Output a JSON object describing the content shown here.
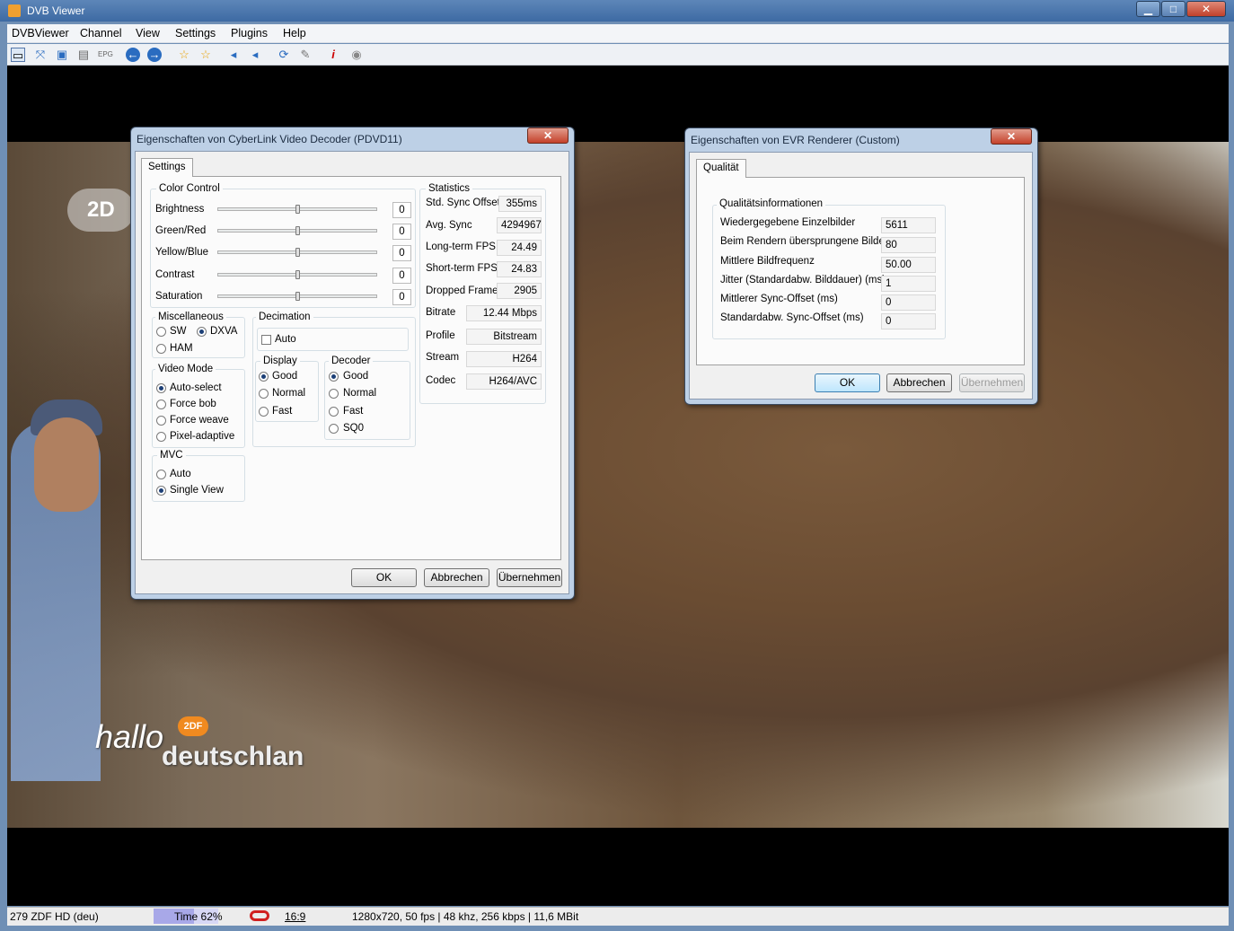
{
  "app": {
    "title": "DVB Viewer"
  },
  "window_buttons": {
    "minimize": "▁",
    "maximize": "□",
    "close": "✕"
  },
  "menu": [
    "DVBViewer",
    "Channel",
    "View",
    "Settings",
    "Plugins",
    "Help"
  ],
  "toolbar_icons": [
    "window-icon",
    "fullscreen-icon",
    "desktop-icon",
    "osd-icon",
    "epg-icon",
    "back-icon",
    "forward-icon",
    "favorite-icon",
    "favorite2-icon",
    "volume-down-icon",
    "volume-up-icon",
    "record-icon",
    "tools-icon",
    "info-icon",
    "stop-icon"
  ],
  "video": {
    "logo": "2D",
    "overlay_line1": "hallo",
    "overlay_line2": "deutschlan",
    "overlay_logo": "2DF"
  },
  "statusbar": {
    "channel": "279 ZDF HD (deu)",
    "time": "Time 62%",
    "time_progress": 0.62,
    "aspect": "16:9",
    "info": "1280x720, 50 fps | 48 khz, 256 kbps | 11,6 MBit"
  },
  "decoder_dialog": {
    "title": "Eigenschaften von CyberLink Video Decoder (PDVD11)",
    "tab": "Settings",
    "color_control": {
      "label": "Color Control",
      "rows": [
        {
          "label": "Brightness",
          "value": "0"
        },
        {
          "label": "Green/Red",
          "value": "0"
        },
        {
          "label": "Yellow/Blue",
          "value": "0"
        },
        {
          "label": "Contrast",
          "value": "0"
        },
        {
          "label": "Saturation",
          "value": "0"
        }
      ]
    },
    "misc": {
      "label": "Miscellaneous",
      "sw": "SW",
      "dxva": "DXVA",
      "ham": "HAM"
    },
    "decimation": {
      "label": "Decimation",
      "auto": "Auto"
    },
    "display": {
      "label": "Display",
      "options": [
        "Good",
        "Normal",
        "Fast"
      ]
    },
    "decoder": {
      "label": "Decoder",
      "options": [
        "Good",
        "Normal",
        "Fast",
        "SQ0"
      ]
    },
    "video_mode": {
      "label": "Video Mode",
      "options": [
        "Auto-select",
        "Force bob",
        "Force weave",
        "Pixel-adaptive"
      ]
    },
    "mvc": {
      "label": "MVC",
      "options": [
        "Auto",
        "Single View"
      ]
    },
    "statistics": {
      "label": "Statistics",
      "rows": [
        {
          "label": "Std. Sync Offset",
          "value": "355ms"
        },
        {
          "label": "Avg. Sync",
          "value": "4294967"
        },
        {
          "label": "Long-term FPS",
          "value": "24.49"
        },
        {
          "label": "Short-term FPS",
          "value": "24.83"
        },
        {
          "label": "Dropped Frames",
          "value": "2905"
        },
        {
          "label": "Bitrate",
          "value": "12.44 Mbps"
        },
        {
          "label": "Profile",
          "value": "Bitstream"
        },
        {
          "label": "Stream",
          "value": "H264"
        },
        {
          "label": "Codec",
          "value": "H264/AVC"
        }
      ]
    },
    "buttons": {
      "ok": "OK",
      "cancel": "Abbrechen",
      "apply": "Übernehmen"
    }
  },
  "evr_dialog": {
    "title": "Eigenschaften von EVR Renderer (Custom)",
    "tab": "Qualität",
    "group": "Qualitätsinformationen",
    "rows": [
      {
        "label": "Wiedergegebene Einzelbilder",
        "value": "5611"
      },
      {
        "label": "Beim Rendern übersprungene Bilder",
        "value": "80"
      },
      {
        "label": "Mittlere Bildfrequenz",
        "value": "50.00"
      },
      {
        "label": "Jitter (Standardabw. Bilddauer) (ms)",
        "value": "1"
      },
      {
        "label": "Mittlerer Sync-Offset (ms)",
        "value": "0"
      },
      {
        "label": "Standardabw. Sync-Offset (ms)",
        "value": "0"
      }
    ],
    "buttons": {
      "ok": "OK",
      "cancel": "Abbrechen",
      "apply": "Übernehmen"
    }
  }
}
